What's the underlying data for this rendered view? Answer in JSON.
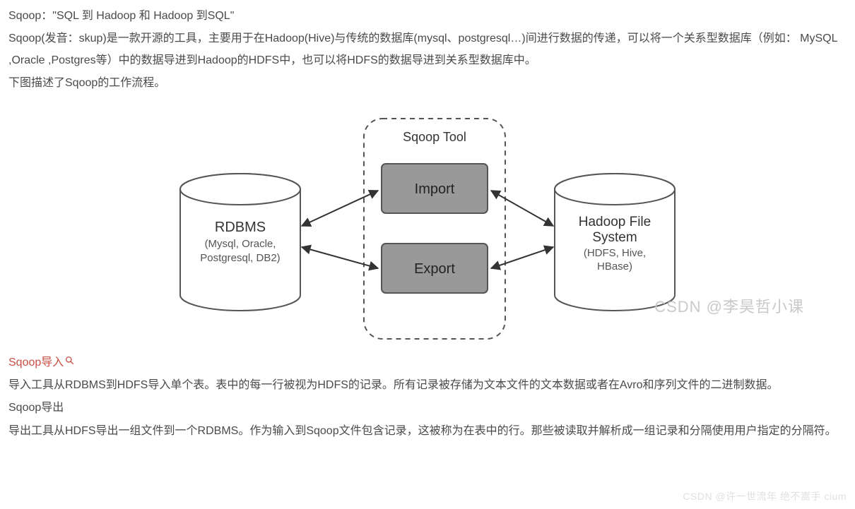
{
  "paragraphs": {
    "line1": "Sqoop：\"SQL 到 Hadoop 和 Hadoop 到SQL\"",
    "line2": "Sqoop(发音：skup)是一款开源的工具，主要用于在Hadoop(Hive)与传统的数据库(mysql、postgresql…)间进行数据的传递，可以将一个关系型数据库（例如： MySQL ,Oracle ,Postgres等）中的数据导进到Hadoop的HDFS中，也可以将HDFS的数据导进到关系型数据库中。",
    "line3": "下图描述了Sqoop的工作流程。",
    "heading_import": "Sqoop导入",
    "import_desc": "导入工具从RDBMS到HDFS导入单个表。表中的每一行被视为HDFS的记录。所有记录被存储为文本文件的文本数据或者在Avro和序列文件的二进制数据。",
    "heading_export": "Sqoop导出",
    "export_desc": "导出工具从HDFS导出一组文件到一个RDBMS。作为输入到Sqoop文件包含记录，这被称为在表中的行。那些被读取并解析成一组记录和分隔使用用户指定的分隔符。"
  },
  "diagram": {
    "tool_label": "Sqoop Tool",
    "import_label": "Import",
    "export_label": "Export",
    "left_title": "RDBMS",
    "left_sub": "(Mysql, Oracle, Postgresql, DB2)",
    "right_title": "Hadoop File System",
    "right_sub": "(HDFS, Hive, HBase)"
  },
  "watermarks": {
    "diagram": "CSDN @李昊哲小课",
    "footer": "CSDN @许一世流年 绝不嵩手 cium"
  }
}
